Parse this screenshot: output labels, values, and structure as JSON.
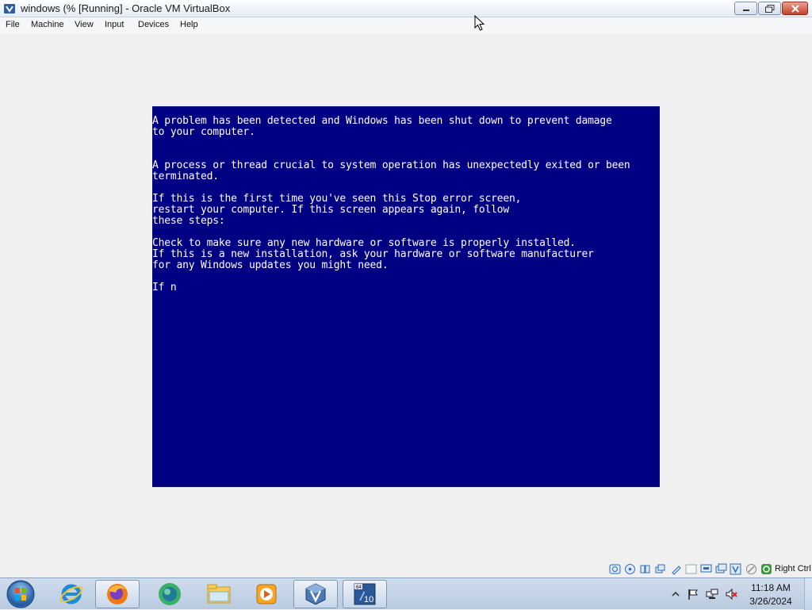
{
  "window": {
    "title": "windows (% [Running] - Oracle VM VirtualBox",
    "app_icon": "virtualbox-icon"
  },
  "menu": [
    {
      "label": "File"
    },
    {
      "label": "Machine"
    },
    {
      "label": "View"
    },
    {
      "label": "Input"
    },
    {
      "label": "Devices"
    },
    {
      "label": "Help"
    }
  ],
  "guest": {
    "bsod_background": "#000082",
    "bsod_text_color": "#ffffff",
    "bsod_lines": "A problem has been detected and Windows has been shut down to prevent damage\nto your computer.\n\n\nA process or thread crucial to system operation has unexpectedly exited or been\nterminated.\n\nIf this is the first time you've seen this Stop error screen,\nrestart your computer. If this screen appears again, follow\nthese steps:\n\nCheck to make sure any new hardware or software is properly installed.\nIf this is a new installation, ask your hardware or software manufacturer\nfor any Windows updates you might need.\n\nIf n"
  },
  "statusbar": {
    "host_key": "Right Ctrl",
    "icons": [
      "hard-disk-icon",
      "optical-drive-icon",
      "audio-icon",
      "network-icon",
      "usb-icon",
      "shared-folders-icon",
      "display-icon",
      "video-capture-icon",
      "cpu-virtualization-icon",
      "mouse-integration-icon",
      "keyboard-capture-icon"
    ]
  },
  "taskbar": {
    "apps": [
      "internet-explorer-icon",
      "firefox-icon",
      "bluestacks-icon",
      "file-explorer-icon",
      "media-player-icon",
      "virtualbox-icon",
      "windows-10-vm-icon"
    ],
    "clock_time": "11:18 AM",
    "clock_date": "3/26/2024",
    "tray_icons": [
      "show-hidden-icons-icon",
      "action-center-flag-icon",
      "network-icon",
      "volume-muted-icon"
    ]
  }
}
